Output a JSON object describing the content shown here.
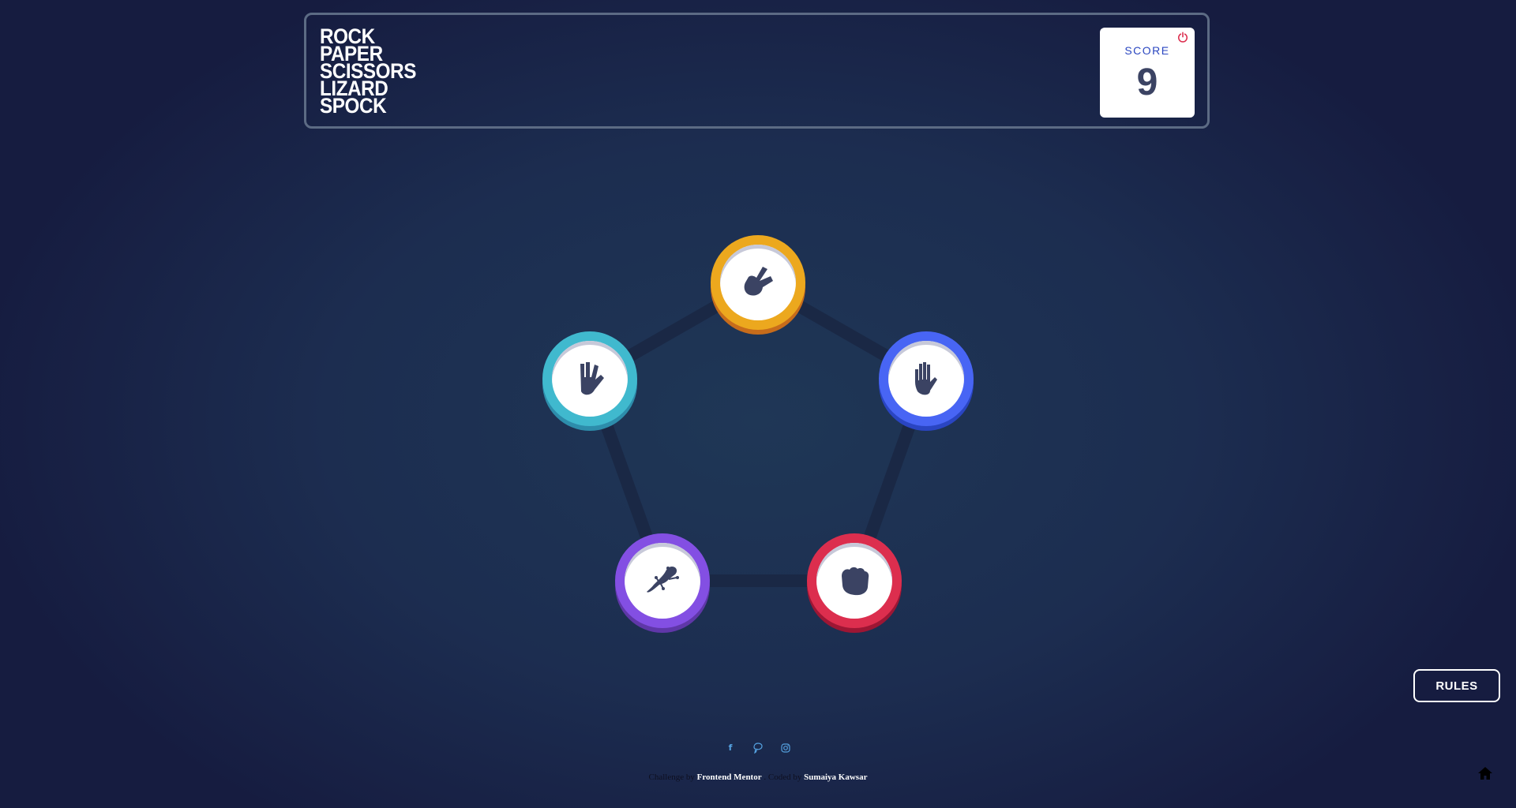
{
  "header": {
    "title_lines": [
      "ROCK",
      "PAPER",
      "SCISSORS",
      "LIZARD",
      "SPOCK"
    ],
    "score_label": "SCORE",
    "score_value": "9",
    "reset_icon": "power-reset-icon"
  },
  "game": {
    "tokens": [
      {
        "name": "scissors",
        "icon": "scissors-hand-icon",
        "color": "#eca81e"
      },
      {
        "name": "paper",
        "icon": "paper-hand-icon",
        "color": "#4865f4"
      },
      {
        "name": "rock",
        "icon": "rock-fist-icon",
        "color": "#dc2e4e"
      },
      {
        "name": "lizard",
        "icon": "lizard-icon",
        "color": "#834fe3"
      },
      {
        "name": "spock",
        "icon": "spock-hand-icon",
        "color": "#40b9ce"
      }
    ]
  },
  "rules_button": {
    "label": "RULES"
  },
  "footer": {
    "social_icons": [
      "facebook-icon",
      "pinterest-icon",
      "instagram-icon"
    ],
    "challenge_prefix": "Challenge by",
    "challenge_link": "Frontend Mentor",
    "coded_prefix": ". Coded by",
    "coded_link": "Sumaiya Kawsar"
  },
  "colors": {
    "background_dark": "#161c40",
    "background_light": "#1f3756",
    "score_text": "#3b4363",
    "score_label": "#2a46c0"
  }
}
